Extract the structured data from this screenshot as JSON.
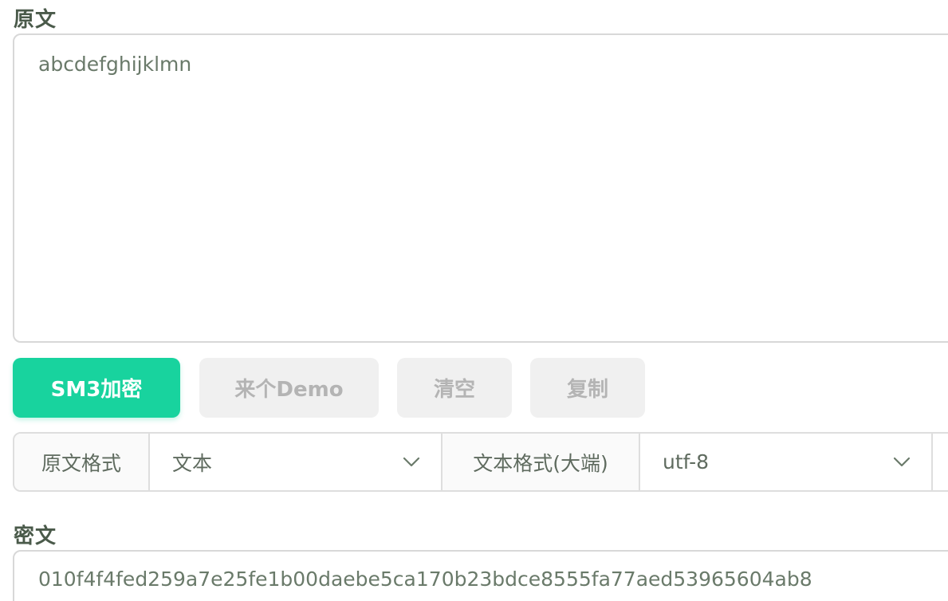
{
  "plain_section": {
    "label": "原文",
    "value": "abcdefghijklmn"
  },
  "actions": {
    "encrypt_label": "SM3加密",
    "demo_label": "来个Demo",
    "clear_label": "清空",
    "copy_label": "复制"
  },
  "format_bar": {
    "input_format_label": "原文格式",
    "input_format_value": "文本",
    "text_encoding_label": "文本格式(大端)",
    "text_encoding_value": "utf-8"
  },
  "cipher_section": {
    "label": "密文",
    "value": "010f4f4fed259a7e25fe1b00daebe5ca170b23bdce8555fa77aed53965604ab8"
  },
  "colors": {
    "primary": "#18d39e",
    "secondary_bg": "#f0f0f0",
    "secondary_text": "#b4b4b4",
    "border": "#d8d8d8"
  },
  "icons": {
    "dropdown": "chevron-down-icon"
  }
}
